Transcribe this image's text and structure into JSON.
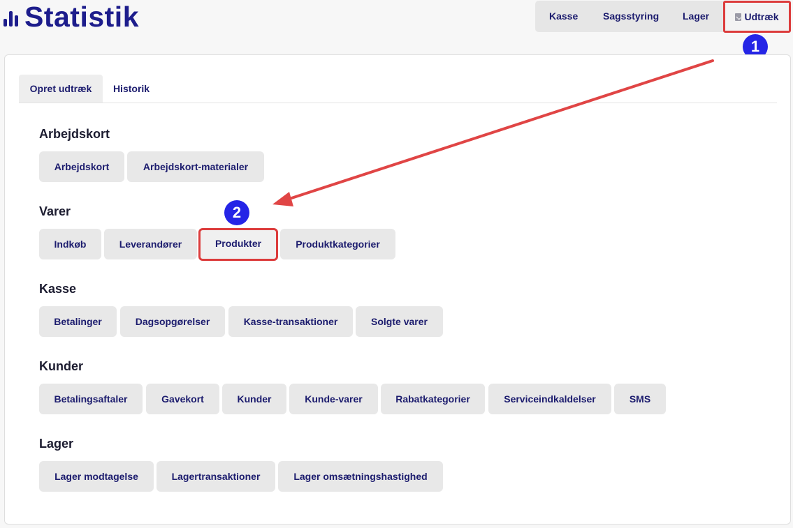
{
  "app": {
    "title": "Statistik"
  },
  "topnav": {
    "kasse": "Kasse",
    "sagsstyring": "Sagsstyring",
    "lager": "Lager",
    "udtraek": "Udtræk"
  },
  "annotations": {
    "badge1": "1",
    "badge2": "2",
    "arrow_color": "#e04545",
    "highlight_color": "#dc3c3c",
    "badge_color": "#2525e6"
  },
  "tabs": {
    "create": "Opret udtræk",
    "history": "Historik"
  },
  "sections": {
    "arbejdskort": {
      "title": "Arbejdskort",
      "buttons": [
        "Arbejdskort",
        "Arbejdskort-materialer"
      ]
    },
    "varer": {
      "title": "Varer",
      "buttons": [
        "Indkøb",
        "Leverandører",
        "Produkter",
        "Produktkategorier"
      ]
    },
    "kasse": {
      "title": "Kasse",
      "buttons": [
        "Betalinger",
        "Dagsopgørelser",
        "Kasse-transaktioner",
        "Solgte varer"
      ]
    },
    "kunder": {
      "title": "Kunder",
      "buttons": [
        "Betalingsaftaler",
        "Gavekort",
        "Kunder",
        "Kunde-varer",
        "Rabatkategorier",
        "Serviceindkaldelser",
        "SMS"
      ]
    },
    "lager": {
      "title": "Lager",
      "buttons": [
        "Lager modtagelse",
        "Lagertransaktioner",
        "Lager omsætningshastighed"
      ]
    }
  }
}
